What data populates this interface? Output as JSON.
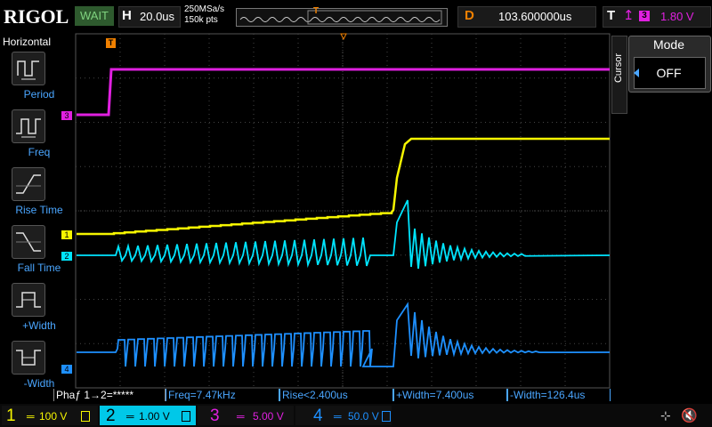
{
  "top_bar": {
    "logo": "RIGOL",
    "run_state": "WAIT",
    "horizontal_label": "H",
    "timebase": "20.0us",
    "sample_rate": "250MSa/s",
    "memory_depth": "150k pts",
    "trigger_marker": "T",
    "delay_label": "D",
    "delay_value": "103.600000us",
    "trigger_label": "T",
    "trigger_slope_icon": "rising-edge-icon",
    "trigger_source": "3",
    "trigger_level": "1.80 V"
  },
  "left_menu": {
    "title": "Horizontal",
    "items": [
      {
        "label": "Period",
        "icon": "period-icon"
      },
      {
        "label": "Freq",
        "icon": "freq-icon"
      },
      {
        "label": "Rise Time",
        "icon": "rise-time-icon"
      },
      {
        "label": "Fall Time",
        "icon": "fall-time-icon"
      },
      {
        "label": "+Width",
        "icon": "pos-width-icon"
      },
      {
        "label": "-Width",
        "icon": "neg-width-icon"
      }
    ]
  },
  "right_menu": {
    "tab": "Cursor",
    "mode_label": "Mode",
    "mode_value": "OFF"
  },
  "markers": {
    "ch3": "3",
    "ch1": "1",
    "ch2": "2",
    "ch4": "4",
    "trigger_pos": "T"
  },
  "measurements": [
    {
      "label": "Phaƒ 1→2=*****"
    },
    {
      "label": "Freq=7.47kHz"
    },
    {
      "label": "Rise<2.400us"
    },
    {
      "label": "+Width=7.400us"
    },
    {
      "label": "-Width=126.4us"
    }
  ],
  "channels": [
    {
      "num": "1",
      "coupling": "═",
      "scale": "100 V",
      "color": "#f5f500"
    },
    {
      "num": "2",
      "coupling": "═",
      "scale": "1.00 V",
      "color": "#00e5ff"
    },
    {
      "num": "3",
      "coupling": "═",
      "scale": "5.00 V",
      "color": "#e020e0"
    },
    {
      "num": "4",
      "coupling": "═",
      "scale": "50.0 V",
      "color": "#1e90ff"
    }
  ],
  "status_icons": [
    "usb-icon",
    "speaker-muted-icon"
  ]
}
